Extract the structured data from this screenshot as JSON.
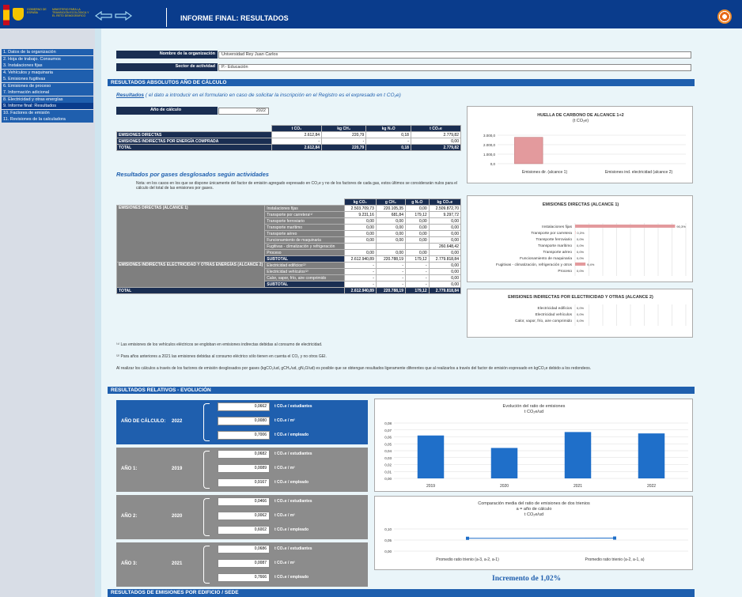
{
  "header": {
    "gov_text_1": "GOBIERNO DE ESPAÑA",
    "gov_text_2": "MINISTERIO PARA LA TRANSICIÓN ECOLÓGICA Y EL RETO DEMOGRÁFICO",
    "title": "INFORME FINAL: RESULTADOS",
    "colors": {
      "bar": "#0a3c8c",
      "accent": "#1f5fae",
      "flag_red": "#c60b1e",
      "flag_yellow": "#ffc400"
    }
  },
  "sidebar": {
    "items": [
      {
        "label": "1. Datos de la organización"
      },
      {
        "label": "2. Hoja de trabajo. Consumos"
      },
      {
        "label": "3. Instalaciones fijas"
      },
      {
        "label": "4. Vehículos y maquinaria"
      },
      {
        "label": "5. Emisiones fugitivas"
      },
      {
        "label": "6. Emisiones de proceso"
      },
      {
        "label": "7. Información adicional"
      },
      {
        "label": "8. Electricidad y otras energías"
      },
      {
        "label": "9. Informe final: Resultados"
      },
      {
        "label": "10. Factores de emisión"
      },
      {
        "label": "11. Revisiones de la calculadora"
      }
    ]
  },
  "org": {
    "name_label": "Nombre de la organización",
    "name_value": "Universidad Rey Juan Carlos",
    "sector_label": "Sector de actividad",
    "sector_value": "P.- Educación"
  },
  "absolute": {
    "bar": "RESULTADOS ABSOLUTOS AÑO DE CÁLCULO",
    "sub_heading": "Resultados",
    "sub_note": "( el dato a introducir en el formulario en caso de solicitar la inscripción en el Registro es el expresado en t CO₂e)",
    "year_label": "Año de cálculo",
    "year_value": "2022",
    "columns": [
      "t CO₂",
      "kg CH₄",
      "kg N₂O",
      "t CO₂e"
    ],
    "rows": [
      {
        "label": "EMISIONES DIRECTAS",
        "values": [
          "2.612,84",
          "220,79",
          "0,18",
          "2.779,82"
        ]
      },
      {
        "label": "EMISIONES INDIRECTAS POR ENERGÍA COMPRADA",
        "values": [
          "-",
          "-",
          "-",
          "0,00"
        ]
      },
      {
        "label": "TOTAL",
        "values": [
          "2.612,84",
          "220,79",
          "0,18",
          "2.779,82"
        ]
      }
    ]
  },
  "by_gas": {
    "heading": "Resultados por gases desglosados según actividades",
    "note": "Nota: en los casos en los que se dispone únicamente del factor de emisión agregado expresado en CO₂e y no de los factores de cada gas, estos últimos se considerarán nulos para el cálculo del total de las emisiones por gases.",
    "columns": [
      "kg CO₂",
      "g CH₄",
      "g N₂O",
      "kg CO₂e"
    ],
    "group1_label": "EMISIONES DIRECTAS (ALCANCE 1)",
    "group1_rows": [
      {
        "label": "Instalaciones fijas",
        "values": [
          "2.503.709,73",
          "220.105,35",
          "0,00",
          "2.509.872,70"
        ]
      },
      {
        "label": "Transporte por carretera⁽¹⁾",
        "values": [
          "9.231,16",
          "681,84",
          "179,12",
          "9.297,72"
        ]
      },
      {
        "label": "Transporte ferroviario",
        "values": [
          "0,00",
          "0,00",
          "0,00",
          "0,00"
        ]
      },
      {
        "label": "Transporte marítimo",
        "values": [
          "0,00",
          "0,00",
          "0,00",
          "0,00"
        ]
      },
      {
        "label": "Transporte aéreo",
        "values": [
          "0,00",
          "0,00",
          "0,00",
          "0,00"
        ]
      },
      {
        "label": "Funcionamiento de maquinaria",
        "values": [
          "0,00",
          "0,00",
          "0,00",
          "0,00"
        ]
      },
      {
        "label": "Fugitivas - climatización y refrigeración",
        "values": [
          "",
          "",
          "",
          "260.648,42"
        ]
      },
      {
        "label": "Proceso",
        "values": [
          "0,00",
          "0,00",
          "0,00",
          "0,00"
        ]
      },
      {
        "label": "SUBTOTAL",
        "values": [
          "2.612.940,89",
          "220.788,19",
          "179,12",
          "2.779.818,84"
        ]
      }
    ],
    "group2_label": "EMISIONES INDIRECTAS ELECTRICIDAD Y OTRAS ENERGÍAS (ALCANCE 2)",
    "group2_rows": [
      {
        "label": "Electricidad edificios⁽²⁾",
        "values": [
          "-",
          "-",
          "-",
          "0,00"
        ]
      },
      {
        "label": "Electricidad vehículos⁽²⁾",
        "values": [
          "-",
          "-",
          "-",
          "0,00"
        ]
      },
      {
        "label": "Calor, vapor, frío, aire comprimido",
        "values": [
          "-",
          "-",
          "-",
          "0,00"
        ]
      },
      {
        "label": "SUBTOTAL",
        "values": [
          "-",
          "-",
          "-",
          "0,00"
        ]
      }
    ],
    "total_row": {
      "label": "TOTAL",
      "values": [
        "2.612.940,89",
        "220.788,19",
        "179,12",
        "2.779.818,84"
      ]
    },
    "footnote1": "⁽¹⁾ Las emisiones de los vehículos eléctricos se engloban en emisiones indirectas debidas al consumo de electricidad.",
    "footnote2": "⁽²⁾ Para años anteriores a 2021 las emisiones debidas al consumo eléctrico sólo tienen en cuenta el CO₂ y no otros GEI.",
    "footnote3": "Al realizar los cálculos a través de los factores de emisión desglosados por gases (kgCO₂/ud, gCH₄/ud, gN₂O/ud) es posible que se obtengan resultados ligeramente diferentes que al realizarlos a través del factor de emisión expresado en kgCO₂e debido a los redondeos."
  },
  "relative": {
    "bar": "RESULTADOS RELATIVOS - EVOLUCIÓN",
    "unit_students": "t CO₂e / estudiantes",
    "unit_m2": "t CO₂e / m²",
    "unit_employee": "t CO₂e / empleado",
    "panels": [
      {
        "label": "AÑO DE CÁLCULO:",
        "year": "2022",
        "values": [
          "0,0662",
          "0,0080",
          "0,7006"
        ]
      },
      {
        "label": "AÑO 1:",
        "year": "2019",
        "values": [
          "0,0682",
          "0,0089",
          "0,9167"
        ]
      },
      {
        "label": "AÑO 2:",
        "year": "2020",
        "values": [
          "0,0466",
          "0,0062",
          "0,6002"
        ]
      },
      {
        "label": "AÑO 3:",
        "year": "2021",
        "values": [
          "0,0686",
          "0,0087",
          "0,7666"
        ]
      }
    ],
    "increment": "Incremento de  1,02%"
  },
  "building_bar": "RESULTADOS DE EMISIONES POR EDIFICIO / SEDE",
  "chart_data": [
    {
      "type": "bar",
      "title": "HUELLA DE CARBONO DE ALCANCE 1+2",
      "subtitle": "(t CO₂e)",
      "categories": [
        "Emisiones dir. (alcance 1)",
        "Emisiones ind. electricidad (alcance 2)"
      ],
      "values": [
        2779.82,
        0
      ],
      "yticks": [
        "0,0",
        "1.000,0",
        "2.000,0",
        "3.000,0"
      ],
      "ylim": [
        0,
        3000
      ],
      "color": "#e39a9d"
    },
    {
      "type": "bar",
      "orientation": "horizontal",
      "title": "EMISIONES DIRECTAS (ALCANCE 1)",
      "categories": [
        "Instalaciones fijas",
        "Transporte por carretera",
        "Transporte ferroviario",
        "Transporte marítimo",
        "Transporte aéreo",
        "Funcionamiento de maquinaria",
        "Fugitivas - climatización, refrigeración y otros",
        "Proceso"
      ],
      "values": [
        90.3,
        0.3,
        0.0,
        0.0,
        0.0,
        0.0,
        9.4,
        0.0
      ],
      "labels": [
        "90,3%",
        "0,3%",
        "0,0%",
        "0,0%",
        "0,0%",
        "0,0%",
        "9,4%",
        "0,0%"
      ],
      "xlim": [
        0,
        100
      ],
      "color": "#e39a9d"
    },
    {
      "type": "bar",
      "orientation": "horizontal",
      "title": "EMISIONES INDIRECTAS POR ELECTRICIDAD Y OTRAS (ALCANCE 2)",
      "categories": [
        "Electricidad edificios",
        "Electricidad vehículos",
        "Calor, vapor, frío, aire comprimido"
      ],
      "values": [
        0.0,
        0.0,
        0.0
      ],
      "labels": [
        "0,0%",
        "0,0%",
        "0,0%"
      ],
      "xlim": [
        0,
        100
      ]
    },
    {
      "type": "bar",
      "title": "Evolución del ratio de emisiones",
      "subtitle": "t CO₂e/ud",
      "categories": [
        "2019",
        "2020",
        "2021",
        "2022"
      ],
      "values": [
        0.062,
        0.044,
        0.067,
        0.065
      ],
      "yticks": [
        "0,00",
        "0,01",
        "0,02",
        "0,03",
        "0,04",
        "0,05",
        "0,06",
        "0,07",
        "0,08"
      ],
      "ylim": [
        0,
        0.08
      ],
      "color": "#1f6fc9"
    },
    {
      "type": "line",
      "title": "Comparación media del ratio de emisiones de dos trienios",
      "subtitle": "a = año de cálculo",
      "subtitle2": "t CO₂e/ud",
      "categories": [
        "Promedio ratio trienio (a-3, a-2, a-1)",
        "Promedio ratio trienio (a-2, a-1, a)"
      ],
      "values": [
        0.058,
        0.059
      ],
      "yticks": [
        "0,00",
        "0,05",
        "0,10"
      ],
      "ylim": [
        0,
        0.1
      ],
      "color": "#1f6fc9"
    }
  ]
}
